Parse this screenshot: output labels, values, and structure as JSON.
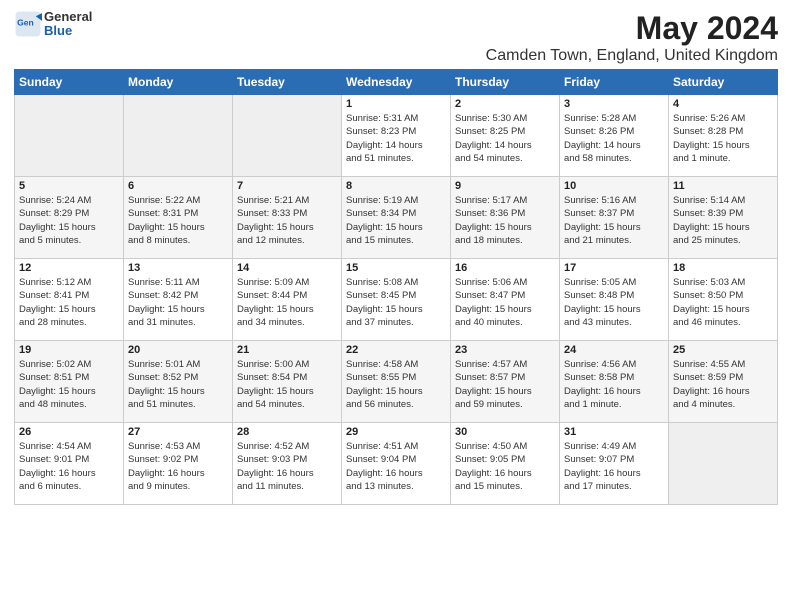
{
  "header": {
    "logo_general": "General",
    "logo_blue": "Blue",
    "title": "May 2024",
    "subtitle": "Camden Town, England, United Kingdom"
  },
  "days_of_week": [
    "Sunday",
    "Monday",
    "Tuesday",
    "Wednesday",
    "Thursday",
    "Friday",
    "Saturday"
  ],
  "weeks": [
    {
      "days": [
        {
          "num": "",
          "info": ""
        },
        {
          "num": "",
          "info": ""
        },
        {
          "num": "",
          "info": ""
        },
        {
          "num": "1",
          "info": "Sunrise: 5:31 AM\nSunset: 8:23 PM\nDaylight: 14 hours\nand 51 minutes."
        },
        {
          "num": "2",
          "info": "Sunrise: 5:30 AM\nSunset: 8:25 PM\nDaylight: 14 hours\nand 54 minutes."
        },
        {
          "num": "3",
          "info": "Sunrise: 5:28 AM\nSunset: 8:26 PM\nDaylight: 14 hours\nand 58 minutes."
        },
        {
          "num": "4",
          "info": "Sunrise: 5:26 AM\nSunset: 8:28 PM\nDaylight: 15 hours\nand 1 minute."
        }
      ]
    },
    {
      "days": [
        {
          "num": "5",
          "info": "Sunrise: 5:24 AM\nSunset: 8:29 PM\nDaylight: 15 hours\nand 5 minutes."
        },
        {
          "num": "6",
          "info": "Sunrise: 5:22 AM\nSunset: 8:31 PM\nDaylight: 15 hours\nand 8 minutes."
        },
        {
          "num": "7",
          "info": "Sunrise: 5:21 AM\nSunset: 8:33 PM\nDaylight: 15 hours\nand 12 minutes."
        },
        {
          "num": "8",
          "info": "Sunrise: 5:19 AM\nSunset: 8:34 PM\nDaylight: 15 hours\nand 15 minutes."
        },
        {
          "num": "9",
          "info": "Sunrise: 5:17 AM\nSunset: 8:36 PM\nDaylight: 15 hours\nand 18 minutes."
        },
        {
          "num": "10",
          "info": "Sunrise: 5:16 AM\nSunset: 8:37 PM\nDaylight: 15 hours\nand 21 minutes."
        },
        {
          "num": "11",
          "info": "Sunrise: 5:14 AM\nSunset: 8:39 PM\nDaylight: 15 hours\nand 25 minutes."
        }
      ]
    },
    {
      "days": [
        {
          "num": "12",
          "info": "Sunrise: 5:12 AM\nSunset: 8:41 PM\nDaylight: 15 hours\nand 28 minutes."
        },
        {
          "num": "13",
          "info": "Sunrise: 5:11 AM\nSunset: 8:42 PM\nDaylight: 15 hours\nand 31 minutes."
        },
        {
          "num": "14",
          "info": "Sunrise: 5:09 AM\nSunset: 8:44 PM\nDaylight: 15 hours\nand 34 minutes."
        },
        {
          "num": "15",
          "info": "Sunrise: 5:08 AM\nSunset: 8:45 PM\nDaylight: 15 hours\nand 37 minutes."
        },
        {
          "num": "16",
          "info": "Sunrise: 5:06 AM\nSunset: 8:47 PM\nDaylight: 15 hours\nand 40 minutes."
        },
        {
          "num": "17",
          "info": "Sunrise: 5:05 AM\nSunset: 8:48 PM\nDaylight: 15 hours\nand 43 minutes."
        },
        {
          "num": "18",
          "info": "Sunrise: 5:03 AM\nSunset: 8:50 PM\nDaylight: 15 hours\nand 46 minutes."
        }
      ]
    },
    {
      "days": [
        {
          "num": "19",
          "info": "Sunrise: 5:02 AM\nSunset: 8:51 PM\nDaylight: 15 hours\nand 48 minutes."
        },
        {
          "num": "20",
          "info": "Sunrise: 5:01 AM\nSunset: 8:52 PM\nDaylight: 15 hours\nand 51 minutes."
        },
        {
          "num": "21",
          "info": "Sunrise: 5:00 AM\nSunset: 8:54 PM\nDaylight: 15 hours\nand 54 minutes."
        },
        {
          "num": "22",
          "info": "Sunrise: 4:58 AM\nSunset: 8:55 PM\nDaylight: 15 hours\nand 56 minutes."
        },
        {
          "num": "23",
          "info": "Sunrise: 4:57 AM\nSunset: 8:57 PM\nDaylight: 15 hours\nand 59 minutes."
        },
        {
          "num": "24",
          "info": "Sunrise: 4:56 AM\nSunset: 8:58 PM\nDaylight: 16 hours\nand 1 minute."
        },
        {
          "num": "25",
          "info": "Sunrise: 4:55 AM\nSunset: 8:59 PM\nDaylight: 16 hours\nand 4 minutes."
        }
      ]
    },
    {
      "days": [
        {
          "num": "26",
          "info": "Sunrise: 4:54 AM\nSunset: 9:01 PM\nDaylight: 16 hours\nand 6 minutes."
        },
        {
          "num": "27",
          "info": "Sunrise: 4:53 AM\nSunset: 9:02 PM\nDaylight: 16 hours\nand 9 minutes."
        },
        {
          "num": "28",
          "info": "Sunrise: 4:52 AM\nSunset: 9:03 PM\nDaylight: 16 hours\nand 11 minutes."
        },
        {
          "num": "29",
          "info": "Sunrise: 4:51 AM\nSunset: 9:04 PM\nDaylight: 16 hours\nand 13 minutes."
        },
        {
          "num": "30",
          "info": "Sunrise: 4:50 AM\nSunset: 9:05 PM\nDaylight: 16 hours\nand 15 minutes."
        },
        {
          "num": "31",
          "info": "Sunrise: 4:49 AM\nSunset: 9:07 PM\nDaylight: 16 hours\nand 17 minutes."
        },
        {
          "num": "",
          "info": ""
        }
      ]
    }
  ]
}
